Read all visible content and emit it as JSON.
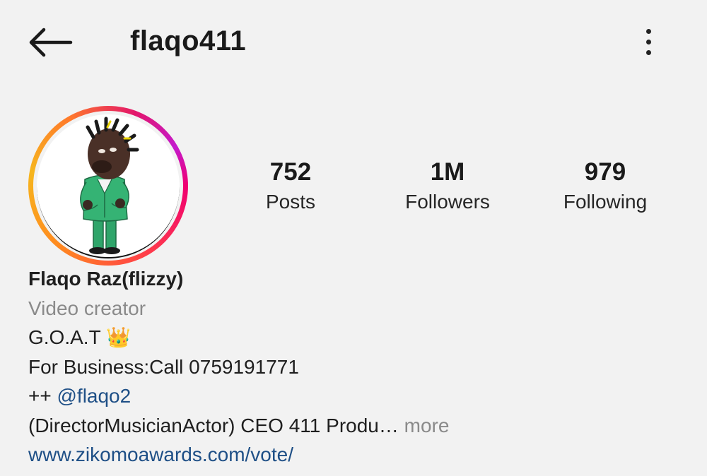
{
  "header": {
    "back_icon": "arrow-left-icon",
    "username": "flaqo411",
    "menu_icon": "more-vertical-icon"
  },
  "profile": {
    "avatar_icon": "cartoon-avatar-image",
    "ring_colors": [
      "#f00070",
      "#ff8a1f",
      "#f6b61f",
      "#c41acd"
    ]
  },
  "stats": [
    {
      "value": "752",
      "label": "Posts"
    },
    {
      "value": "1M",
      "label": "Followers"
    },
    {
      "value": "979",
      "label": "Following"
    }
  ],
  "bio": {
    "name": "Flaqo Raz(flizzy)",
    "category": "Video creator",
    "line1_text": "G.O.A.T ",
    "line1_emoji": "👑",
    "line2": "For Business:Call 0759191771",
    "line3_prefix": "++ ",
    "line3_mention": "@flaqo2",
    "line4_text": " (DirectorMusicianActor) CEO 411 Produ",
    "line4_ellipsis": "…",
    "line4_more": " more",
    "website": "www.zikomoawards.com/vote/"
  },
  "colors": {
    "background": "#f2f2f2",
    "link": "#1e4f86",
    "secondary_text": "#8a8a8a"
  }
}
